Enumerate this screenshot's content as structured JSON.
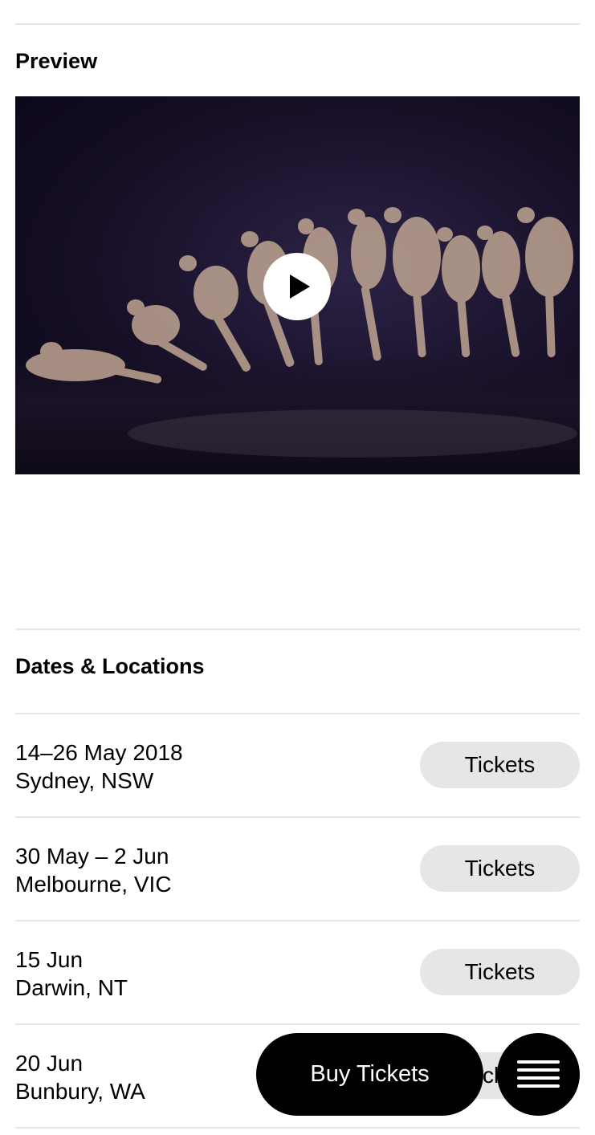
{
  "preview": {
    "title": "Preview",
    "video": {
      "play_icon": "play-icon"
    }
  },
  "dates": {
    "title": "Dates & Locations",
    "rows": [
      {
        "date": "14–26 May 2018",
        "place": "Sydney, NSW",
        "button": "Tickets"
      },
      {
        "date": "30 May – 2 Jun",
        "place": "Melbourne, VIC",
        "button": "Tickets"
      },
      {
        "date": "15 Jun",
        "place": "Darwin, NT",
        "button": "Tickets"
      },
      {
        "date": "20 Jun",
        "place": "Bunbury, WA",
        "button": "Tickets"
      }
    ]
  },
  "floating": {
    "buy_label": "Buy Tickets",
    "menu_icon": "hamburger-menu-icon"
  },
  "colors": {
    "divider": "#e6e6e6",
    "button_bg": "#e6e6e6",
    "primary": "#000000",
    "background": "#ffffff"
  }
}
